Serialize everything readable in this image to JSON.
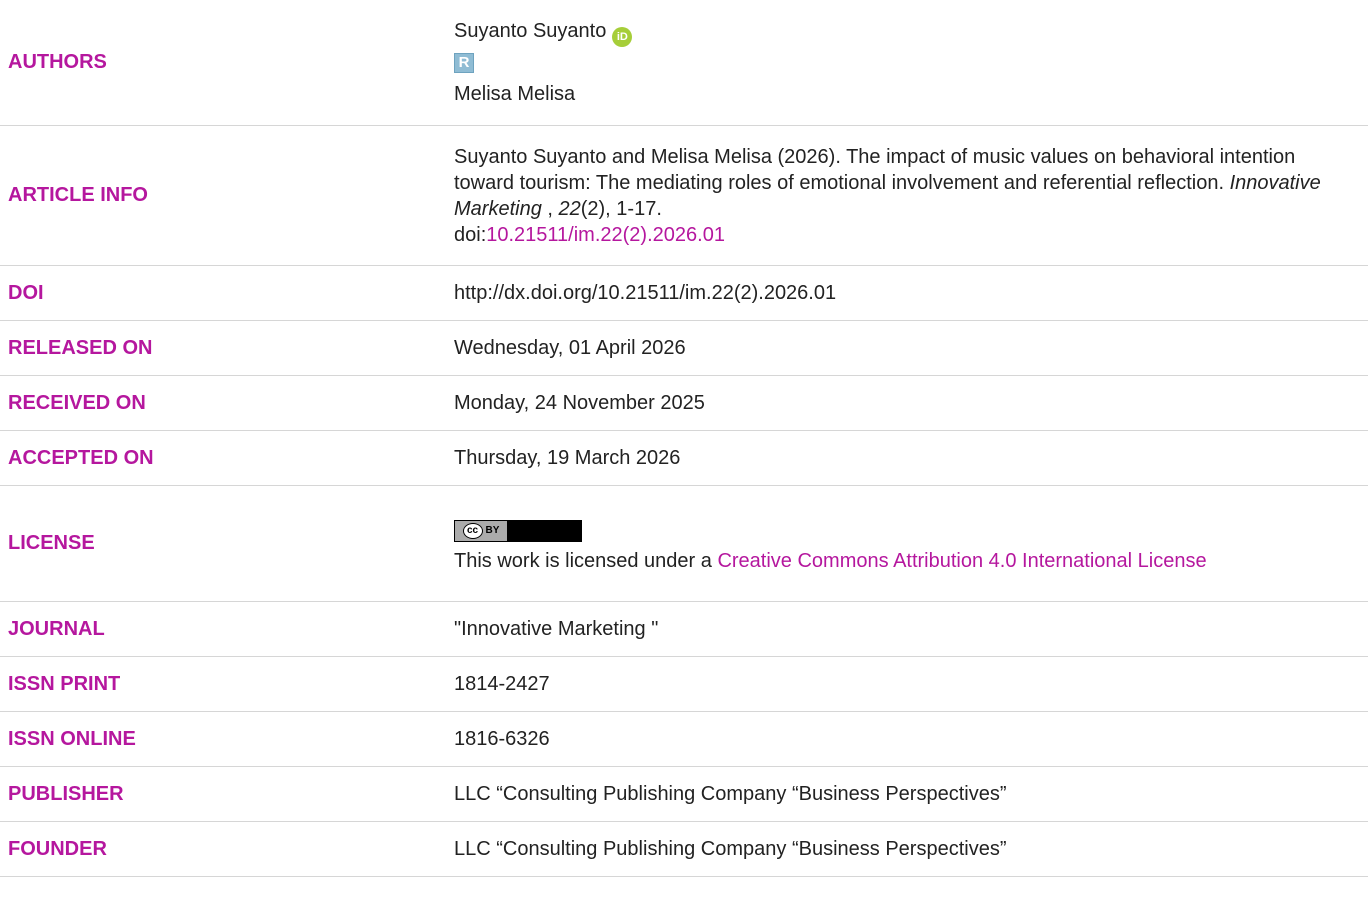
{
  "rows": {
    "authors": {
      "label": "AUTHORS",
      "author1": "Suyanto Suyanto",
      "orcid_icon": "orcid-icon",
      "researchgate_icon": "researchgate-icon",
      "researchgate_letter": "R",
      "orcid_letters": "iD",
      "author2": "Melisa Melisa"
    },
    "article_info": {
      "label": "ARTICLE INFO",
      "citation_prefix": "Suyanto Suyanto and Melisa Melisa (2026). The impact of music values on behavioral intention toward tourism: The mediating roles of emotional involvement and referential reflection. ",
      "journal_italic": "Innovative Marketing",
      "sep1": " , ",
      "volume_italic": "22",
      "issue_pages": "(2), 1-17.",
      "doi_prefix": "doi:",
      "doi_link": "10.21511/im.22(2).2026.01"
    },
    "doi": {
      "label": "DOI",
      "value": "http://dx.doi.org/10.21511/im.22(2).2026.01"
    },
    "released": {
      "label": "RELEASED ON",
      "value": "Wednesday, 01 April 2026"
    },
    "received": {
      "label": "RECEIVED ON",
      "value": "Monday, 24 November 2025"
    },
    "accepted": {
      "label": "ACCEPTED ON",
      "value": "Thursday, 19 March 2026"
    },
    "license": {
      "label": "LICENSE",
      "badge_cc": "cc",
      "badge_by": "BY",
      "text_prefix": "This work is licensed under a ",
      "link_text": "Creative Commons Attribution 4.0 International License"
    },
    "journal": {
      "label": "JOURNAL",
      "value": "\"Innovative Marketing \""
    },
    "issn_print": {
      "label": "ISSN PRINT",
      "value": "1814-2427"
    },
    "issn_online": {
      "label": "ISSN ONLINE",
      "value": "1816-6326"
    },
    "publisher": {
      "label": "PUBLISHER",
      "value": "LLC “Consulting Publishing Company “Business Perspectives”"
    },
    "founder": {
      "label": "FOUNDER",
      "value": "LLC “Consulting Publishing Company “Business Perspectives”"
    }
  },
  "colors": {
    "label": "#b5179e",
    "link": "#b5179e",
    "text": "#222222",
    "divider": "#d6d6d6",
    "orcid": "#a6ce39",
    "researchgate": "#8fbcd4"
  }
}
